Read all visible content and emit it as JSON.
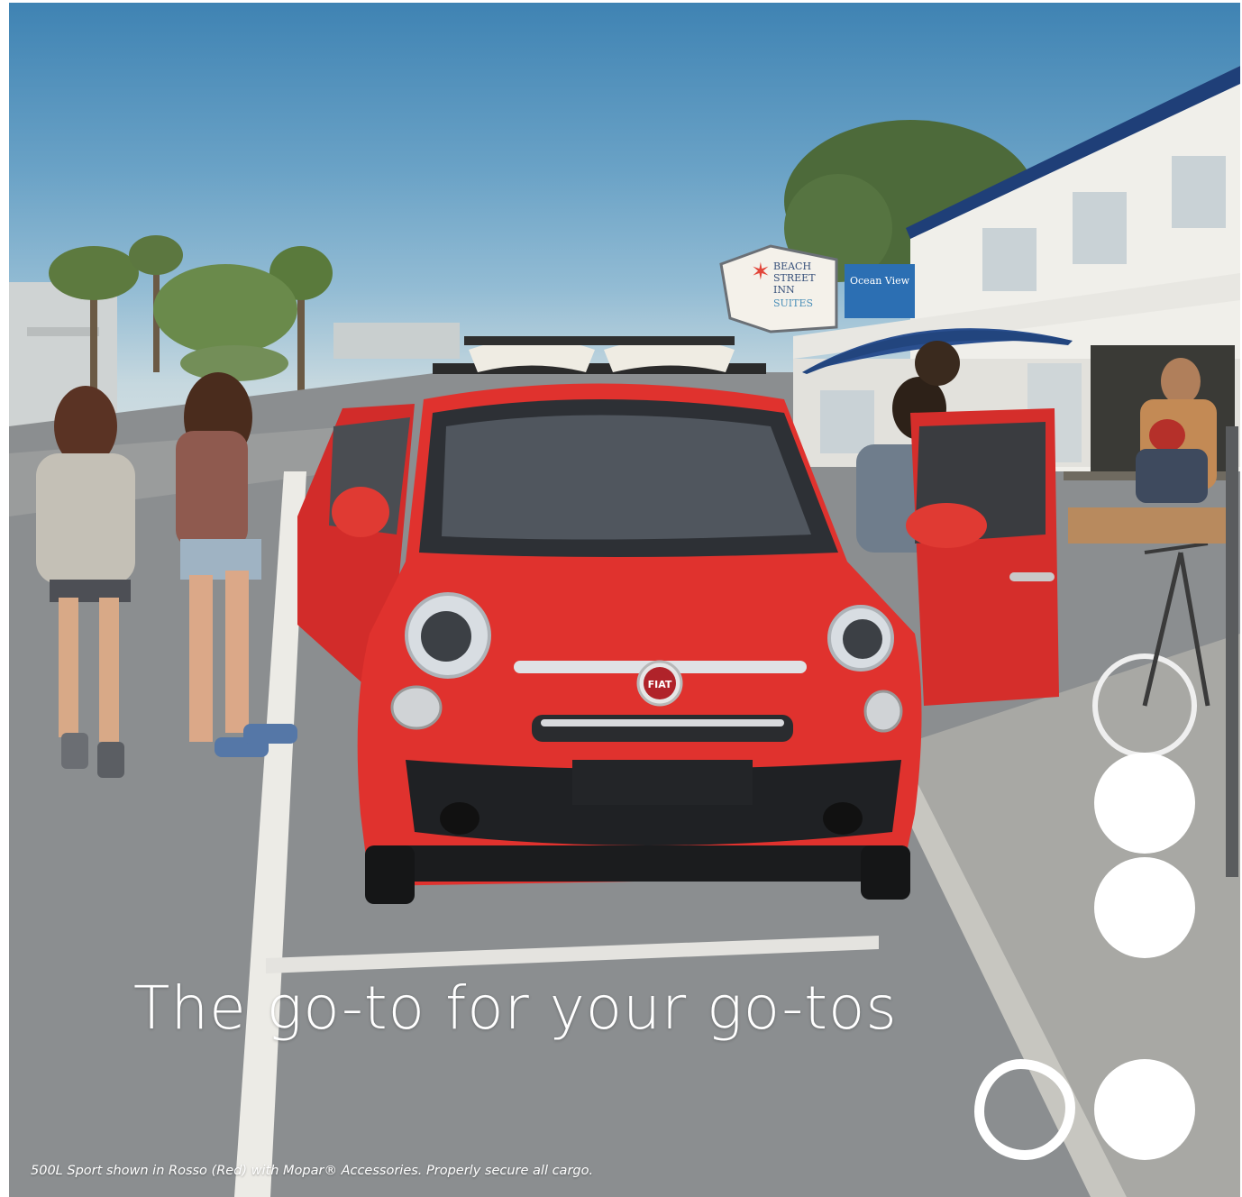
{
  "ad": {
    "headline": "The go-to for your go-tos",
    "disclaimer": "500L Sport shown in Rosso (Red) with Mopar® Accessories. Properly secure all cargo.",
    "badge": "FIAT",
    "signs": {
      "inn_line1": "BEACH",
      "inn_line2": "STREET",
      "inn_line3": "INN",
      "inn_line4": "SUITES",
      "ocean": "Ocean View"
    },
    "dot_pattern": [
      "filled",
      "filled",
      "outlined",
      "filled"
    ]
  },
  "colors": {
    "car_red": "#e0322e",
    "sky_top": "#3f83b3",
    "road": "#8a8e91",
    "dots": "#ffffff"
  }
}
